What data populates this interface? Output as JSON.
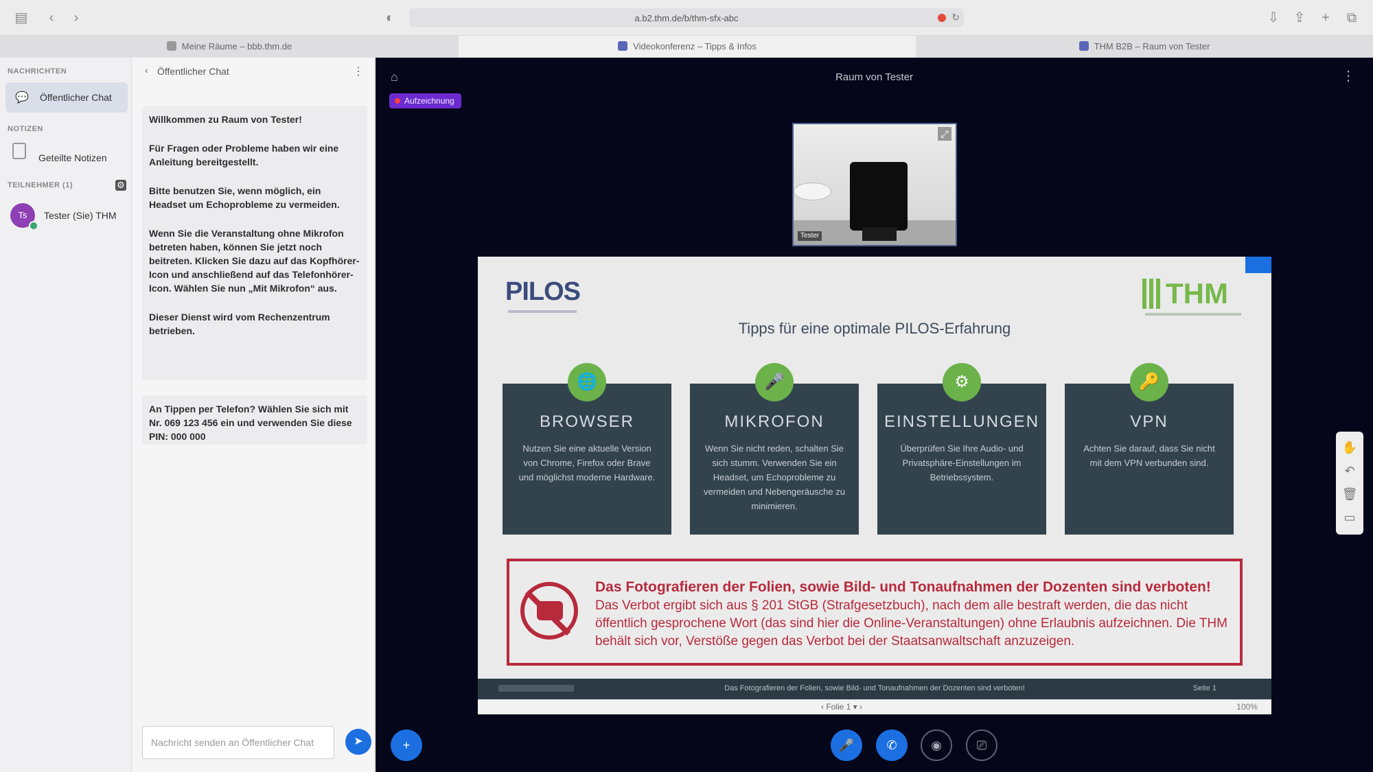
{
  "browser": {
    "url": "a.b2.thm.de/b/thm-sfx-abc",
    "tabs": [
      {
        "label": "Meine Räume – bbb.thm.de"
      },
      {
        "label": "Videokonferenz – Tipps & Infos"
      },
      {
        "label": "THM B2B – Raum von Tester"
      }
    ]
  },
  "sidebar": {
    "section_messages": "NACHRICHTEN",
    "public_chat": "Öffentlicher Chat",
    "section_notes": "NOTIZEN",
    "shared_notes": "Geteilte Notizen",
    "section_users": "TEILNEHMER (1)",
    "participant": {
      "initials": "Ts",
      "name": "Tester (Sie) THM"
    }
  },
  "chat": {
    "title": "Öffentlicher Chat",
    "welcome": [
      "Willkommen zu Raum von Tester!",
      "Für Fragen oder Probleme haben wir eine Anleitung bereitgestellt.",
      "Bitte benutzen Sie, wenn möglich, ein Headset um Echoprobleme zu vermeiden.",
      "Wenn Sie die Veranstaltung ohne Mikrofon betreten haben, können Sie jetzt noch beitreten. Klicken Sie dazu auf das Kopfhörer-Icon und anschließend auf das Telefonhörer-Icon. Wählen Sie nun „Mit Mikrofon“ aus.",
      "Dieser Dienst wird vom Rechenzentrum betrieben."
    ],
    "info": "An Tippen per Telefon? Wählen Sie sich mit Nr. 069 123 456 ein und verwenden Sie diese PIN: 000 000",
    "input_placeholder": "Nachricht senden an Öffentlicher Chat"
  },
  "stage": {
    "title": "Raum von Tester",
    "recording": "Aufzeichnung",
    "webcam_name": "Tester"
  },
  "slide": {
    "logo_left": "PILOS",
    "logo_right": "THM",
    "heading": "Tipps für eine optimale PILOS-Erfahrung",
    "tips": [
      {
        "icon": "🌐",
        "title": "BROWSER",
        "text": "Nutzen Sie eine aktuelle Version von Chrome, Firefox oder Brave und möglichst moderne Hardware."
      },
      {
        "icon": "🎤",
        "title": "MIKROFON",
        "text": "Wenn Sie nicht reden, schalten Sie sich stumm. Verwenden Sie ein Headset, um Echoprobleme zu vermeiden und Nebengeräusche zu minimieren."
      },
      {
        "icon": "⚙",
        "title": "EINSTELLUNGEN",
        "text": "Überprüfen Sie Ihre Audio- und Privatsphäre-Einstellungen im Betriebssystem."
      },
      {
        "icon": "🔑",
        "title": "VPN",
        "text": "Achten Sie darauf, dass Sie nicht mit dem VPN verbunden sind."
      }
    ],
    "warning_title": "Das Fotografieren der Folien, sowie Bild- und Tonaufnahmen der Dozenten sind verboten!",
    "warning_text": "Das Verbot ergibt sich aus § 201 StGB (Strafgesetzbuch), nach dem alle bestraft werden, die das nicht öffentlich gesprochene Wort (das sind hier die Online-Veranstaltungen) ohne Erlaubnis aufzeichnen. Die THM behält sich vor, Verstöße gegen das Verbot bei der Staatsanwaltschaft anzuzeigen.",
    "footer_text": "Das Fotografieren der Folien, sowie Bild- und Tonaufnahmen der Dozenten sind verboten!",
    "footer_page": "Seite 1",
    "nav_label": "‹  Folie 1  ▾  ›",
    "zoom_label": "100%"
  },
  "colors": {
    "stage_bg": "#05061a",
    "accent": "#1b6fe0",
    "tip_green": "#6bb24a",
    "warning_red": "#b72a3c"
  }
}
